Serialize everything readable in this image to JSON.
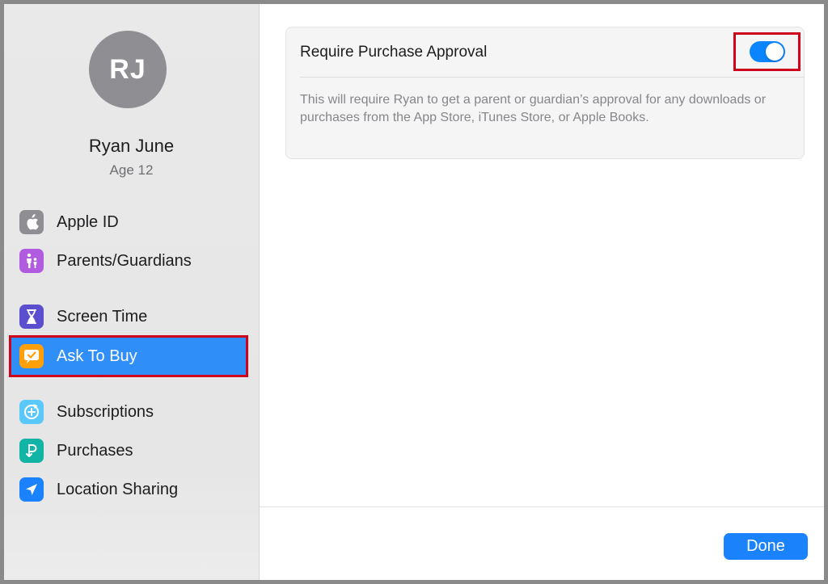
{
  "user": {
    "initials": "RJ",
    "name": "Ryan June",
    "age": "Age 12"
  },
  "sidebar": {
    "items": [
      {
        "label": "Apple ID",
        "icon": "apple-logo-icon",
        "color": "#8e8e93"
      },
      {
        "label": "Parents/Guardians",
        "icon": "family-icon",
        "color": "#b15ce0"
      },
      {
        "label": "Screen Time",
        "icon": "hourglass-icon",
        "color": "#5b4fcf"
      },
      {
        "label": "Ask To Buy",
        "icon": "ask-to-buy-icon",
        "color": "#ff9f0a",
        "selected": true
      },
      {
        "label": "Subscriptions",
        "icon": "subscriptions-icon",
        "color": "#5ac8fa"
      },
      {
        "label": "Purchases",
        "icon": "purchases-icon",
        "color": "#12b5a5"
      },
      {
        "label": "Location Sharing",
        "icon": "location-arrow-icon",
        "color": "#1a82fb"
      }
    ]
  },
  "setting": {
    "title": "Require Purchase Approval",
    "enabled": true,
    "description": "This will require Ryan to get a parent or guardian’s approval for any downloads or purchases from the App Store, iTunes Store, or Apple Books."
  },
  "footer": {
    "done_label": "Done"
  },
  "colors": {
    "accent": "#0a84ff",
    "selection": "#2f8ef7",
    "highlight_box": "#d0021b"
  }
}
